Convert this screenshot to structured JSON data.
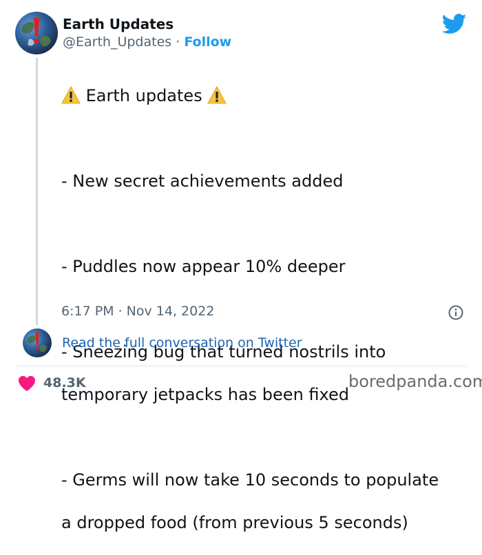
{
  "author": {
    "display_name": "Earth Updates",
    "handle": "@Earth_Updates",
    "separator": "·",
    "follow_label": "Follow"
  },
  "tweet": {
    "heading": "Earth updates",
    "lines": [
      "- New secret achievements added",
      "- Puddles now appear 10% deeper",
      "- Sneezing bug that turned nostrils into",
      "temporary jetpacks has been fixed",
      "- Germs will now take 10 seconds to populate",
      "a dropped food (from previous 5 seconds)"
    ],
    "timestamp": "6:17 PM · Nov 14, 2022"
  },
  "conversation_link": "Read the full conversation on Twitter",
  "likes_count": "48.3K",
  "watermark": "boredpanda.com",
  "icons": {
    "brand": "twitter-bird-icon",
    "warning": "warning-icon",
    "info": "info-icon",
    "like": "heart-icon"
  },
  "colors": {
    "twitter_blue": "#1d9bf0",
    "link_blue": "#1d63b0",
    "muted": "#536471",
    "heart": "#f91880",
    "warning": "#f6c244"
  }
}
